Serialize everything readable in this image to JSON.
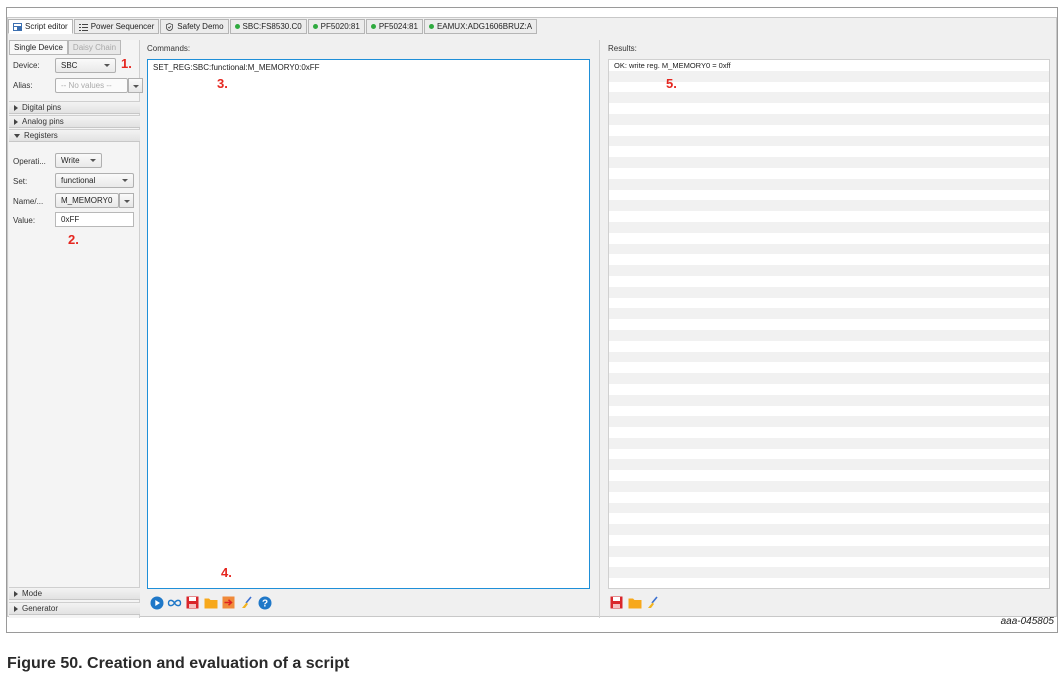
{
  "tabs": [
    {
      "label": "Script editor",
      "icon": "script-editor-icon",
      "active": true
    },
    {
      "label": "Power Sequencer",
      "icon": "list-icon"
    },
    {
      "label": "Safety Demo",
      "icon": "shield-icon"
    },
    {
      "label": "SBC:FS8530.C0",
      "icon": "status-dot"
    },
    {
      "label": "PF5020:81",
      "icon": "status-dot"
    },
    {
      "label": "PF5024:81",
      "icon": "status-dot"
    },
    {
      "label": "EAMUX:ADG1606BRUZ:A",
      "icon": "status-dot"
    }
  ],
  "left": {
    "subtabs": {
      "single": "Single Device",
      "daisy": "Daisy Chain"
    },
    "device_label": "Device:",
    "device_value": "SBC",
    "alias_label": "Alias:",
    "alias_placeholder": "-- No values --",
    "sections": {
      "digital": "Digital pins",
      "analog": "Analog pins",
      "registers": "Registers",
      "mode": "Mode",
      "generator": "Generator"
    },
    "registers": {
      "operation_label": "Operati...",
      "operation_value": "Write",
      "set_label": "Set:",
      "set_value": "functional",
      "name_label": "Name/...",
      "name_value": "M_MEMORY0",
      "value_label": "Value:",
      "value_value": "0xFF"
    }
  },
  "commands": {
    "label": "Commands:",
    "text": "SET_REG:SBC:functional:M_MEMORY0:0xFF"
  },
  "results": {
    "label": "Results:",
    "rows": [
      "OK: write reg. M_MEMORY0 = 0xff"
    ]
  },
  "annotations": {
    "a1": "1.",
    "a2": "2.",
    "a3": "3.",
    "a4": "4.",
    "a5": "5."
  },
  "figure_code": "aaa-045805",
  "caption": "Figure 50.  Creation and evaluation of a script",
  "colors": {
    "accent": "#1e8fd8",
    "annotation": "#e5261f",
    "status_dot": "#2faa3f"
  }
}
